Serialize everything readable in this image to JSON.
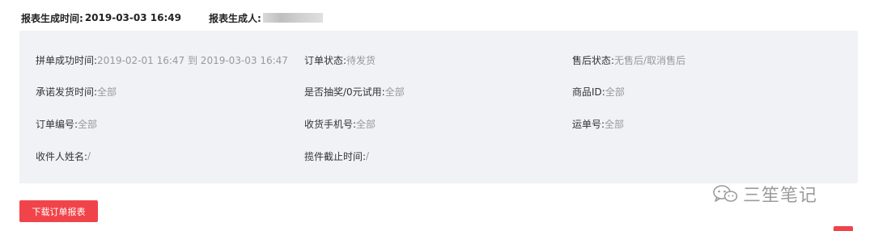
{
  "header": {
    "time_label": "报表生成时间:",
    "time_value": "2019-03-03 16:49",
    "creator_label": "报表生成人:"
  },
  "filters": {
    "group_success_time": {
      "label": "拼单成功时间:",
      "value": "2019-02-01 16:47 到 2019-03-03 16:47"
    },
    "order_status": {
      "label": "订单状态:",
      "value": "待发货"
    },
    "after_sale_status": {
      "label": "售后状态:",
      "value": "无售后/取消售后"
    },
    "promised_ship_time": {
      "label": "承诺发货时间:",
      "value": "全部"
    },
    "lottery_trial": {
      "label": "是否抽奖/0元试用:",
      "value": "全部"
    },
    "product_id": {
      "label": "商品ID:",
      "value": "全部"
    },
    "order_number": {
      "label": "订单编号:",
      "value": "全部"
    },
    "receiver_phone": {
      "label": "收货手机号:",
      "value": "全部"
    },
    "tracking_number": {
      "label": "运单号:",
      "value": "全部"
    },
    "receiver_name": {
      "label": "收件人姓名:",
      "value": "/"
    },
    "pickup_deadline": {
      "label": "揽件截止时间:",
      "value": "/"
    }
  },
  "actions": {
    "download_label": "下载订单报表"
  },
  "watermark": {
    "text": "三笙笔记",
    "icon": "wechat-icon"
  },
  "colors": {
    "accent": "#f0444a",
    "panel_bg": "#f0f2f5",
    "label_text": "#333333",
    "value_text": "#999999"
  }
}
